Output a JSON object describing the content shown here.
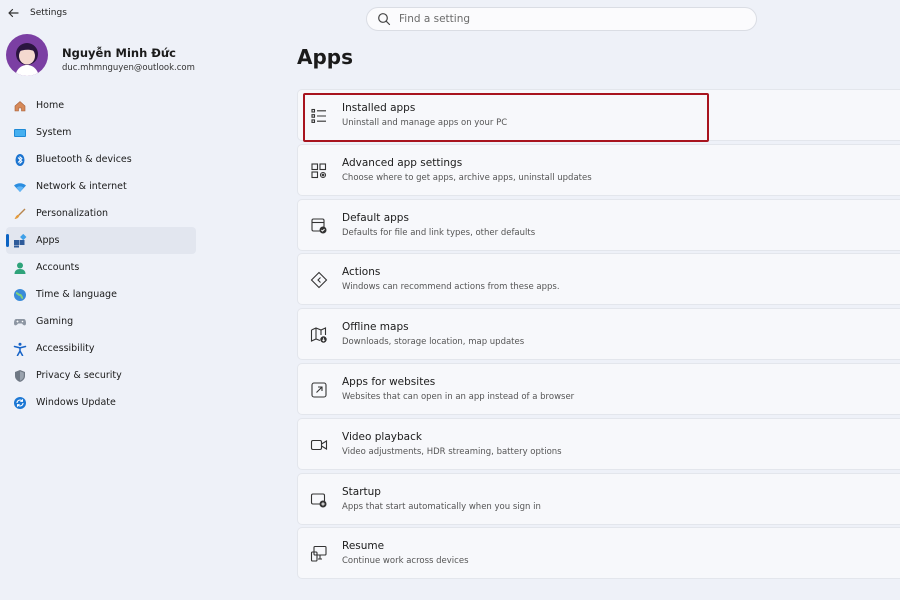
{
  "window": {
    "title": "Settings",
    "back_icon": "back-arrow-icon"
  },
  "search": {
    "placeholder": "Find a setting",
    "value": ""
  },
  "profile": {
    "name": "Nguyễn Minh Đức",
    "email": "duc.mhmnguyen@outlook.com"
  },
  "sidebar": {
    "active": "Apps",
    "items": [
      {
        "label": "Home",
        "icon": "home-icon"
      },
      {
        "label": "System",
        "icon": "system-icon"
      },
      {
        "label": "Bluetooth & devices",
        "icon": "bluetooth-icon"
      },
      {
        "label": "Network & internet",
        "icon": "wifi-icon"
      },
      {
        "label": "Personalization",
        "icon": "brush-icon"
      },
      {
        "label": "Apps",
        "icon": "apps-icon"
      },
      {
        "label": "Accounts",
        "icon": "accounts-icon"
      },
      {
        "label": "Time & language",
        "icon": "globe-icon"
      },
      {
        "label": "Gaming",
        "icon": "gamepad-icon"
      },
      {
        "label": "Accessibility",
        "icon": "accessibility-icon"
      },
      {
        "label": "Privacy & security",
        "icon": "shield-icon"
      },
      {
        "label": "Windows Update",
        "icon": "update-icon"
      }
    ]
  },
  "page": {
    "title": "Apps"
  },
  "cards": [
    {
      "title": "Installed apps",
      "subtitle": "Uninstall and manage apps on your PC",
      "icon": "list-icon",
      "highlighted": true
    },
    {
      "title": "Advanced app settings",
      "subtitle": "Choose where to get apps, archive apps, uninstall updates",
      "icon": "app-settings-icon"
    },
    {
      "title": "Default apps",
      "subtitle": "Defaults for file and link types, other defaults",
      "icon": "default-apps-icon"
    },
    {
      "title": "Actions",
      "subtitle": "Windows can recommend actions from these apps.",
      "icon": "actions-icon"
    },
    {
      "title": "Offline maps",
      "subtitle": "Downloads, storage location, map updates",
      "icon": "map-icon"
    },
    {
      "title": "Apps for websites",
      "subtitle": "Websites that can open in an app instead of a browser",
      "icon": "open-external-icon"
    },
    {
      "title": "Video playback",
      "subtitle": "Video adjustments, HDR streaming, battery options",
      "icon": "video-icon"
    },
    {
      "title": "Startup",
      "subtitle": "Apps that start automatically when you sign in",
      "icon": "startup-icon"
    },
    {
      "title": "Resume",
      "subtitle": "Continue work across devices",
      "icon": "resume-icon"
    }
  ],
  "colors": {
    "accent": "#0b63c3",
    "highlight_border": "#a8141e",
    "background": "#eef1f8",
    "card": "#f7f8fb"
  }
}
